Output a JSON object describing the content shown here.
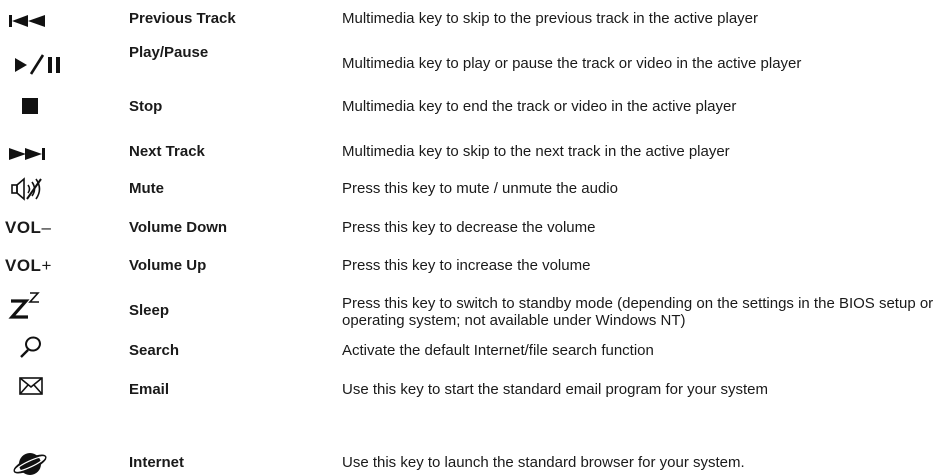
{
  "keys": [
    {
      "icon": "previous-track-icon",
      "name": "Previous Track",
      "description": "Multimedia key to skip to the previous track in the active player"
    },
    {
      "icon": "play-pause-icon",
      "name": "Play/Pause",
      "description": "Multimedia key to play or pause the track or video in the active player"
    },
    {
      "icon": "stop-icon",
      "name": "Stop",
      "description": "Multimedia key to end the track or video in the active player"
    },
    {
      "icon": "next-track-icon",
      "name": "Next Track",
      "description": "Multimedia key to skip to the next track in the active player"
    },
    {
      "icon": "mute-icon",
      "name": "Mute",
      "description": "Press this key to mute / unmute the audio"
    },
    {
      "icon": "volume-down-icon",
      "icon_text": "VOL",
      "icon_sign": "–",
      "name": "Volume Down",
      "description": "Press this key to decrease the volume"
    },
    {
      "icon": "volume-up-icon",
      "icon_text": "VOL",
      "icon_sign": "+",
      "name": "Volume Up",
      "description": "Press this key to increase the volume"
    },
    {
      "icon": "sleep-icon",
      "name": "Sleep",
      "description": "Press this key to switch to standby mode (depending on the settings in the BIOS setup or operating system; not available under Windows NT)"
    },
    {
      "icon": "search-icon",
      "name": "Search",
      "description": "Activate the default Internet/file search function"
    },
    {
      "icon": "email-icon",
      "name": "Email",
      "description": "Use this key to start the standard email program for your system"
    },
    {
      "icon": "internet-icon",
      "name": "Internet",
      "description": "Use this key to launch the standard browser for your system."
    }
  ]
}
